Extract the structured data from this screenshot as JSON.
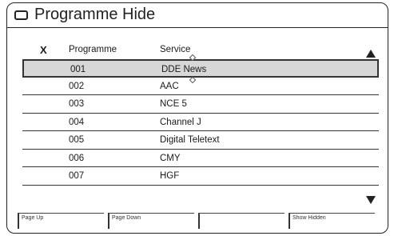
{
  "window": {
    "title": "Programme Hide",
    "icon": "tv-icon"
  },
  "columns": {
    "mark": "X",
    "programme": "Programme",
    "service": "Service"
  },
  "rows": [
    {
      "programme": "001",
      "service": "DDE News",
      "selected": true
    },
    {
      "programme": "002",
      "service": "AAC",
      "selected": false
    },
    {
      "programme": "003",
      "service": "NCE 5",
      "selected": false
    },
    {
      "programme": "004",
      "service": "Channel J",
      "selected": false
    },
    {
      "programme": "005",
      "service": "Digital Teletext",
      "selected": false
    },
    {
      "programme": "006",
      "service": "CMY",
      "selected": false
    },
    {
      "programme": "007",
      "service": "HGF",
      "selected": false
    }
  ],
  "scroll": {
    "up_icon": "triangle-up-icon",
    "down_icon": "triangle-down-icon"
  },
  "footer": {
    "buttons": [
      "Page Up",
      "Page Down",
      "",
      "Show Hidden"
    ]
  }
}
